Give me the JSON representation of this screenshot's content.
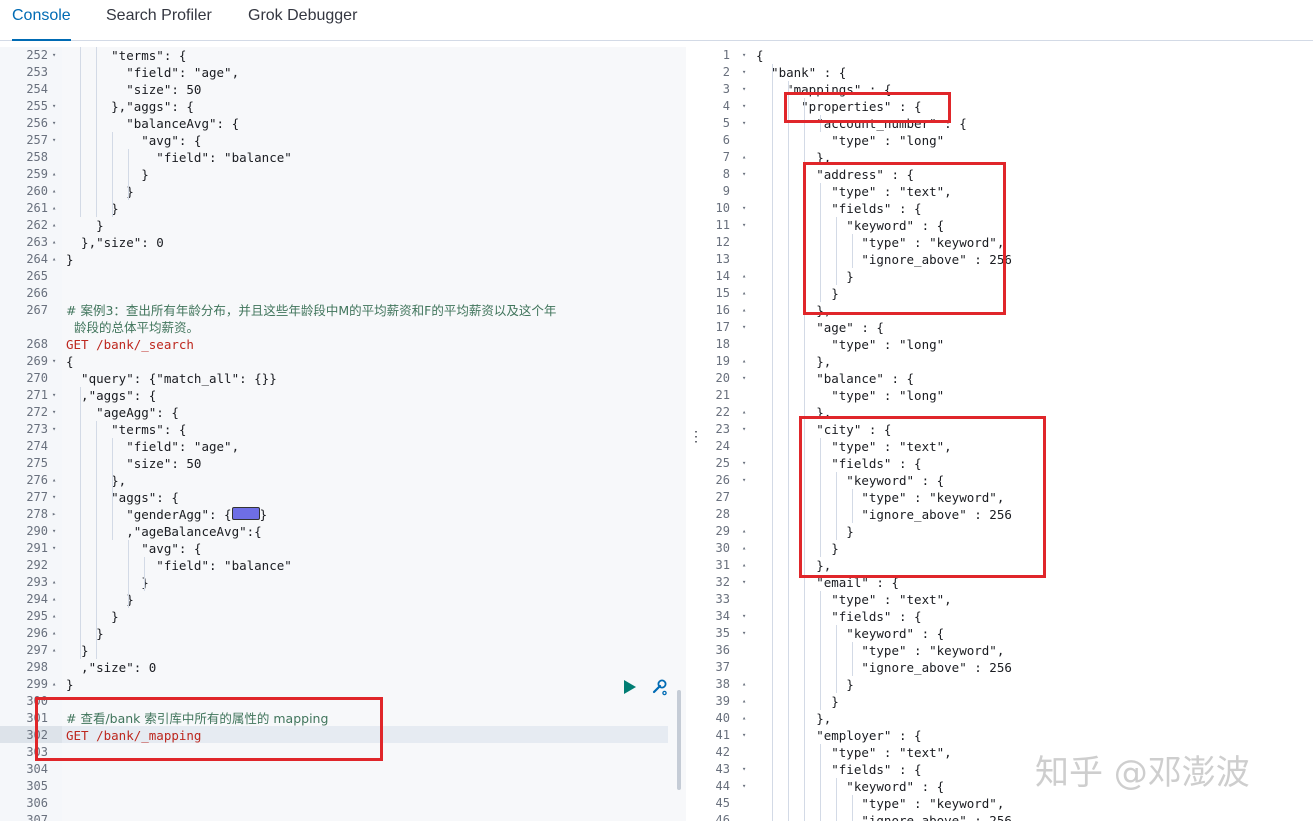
{
  "tabs": [
    "Console",
    "Search Profiler",
    "Grok Debugger"
  ],
  "resizer_icon": "⋮",
  "watermark": "知乎 @邓澎波",
  "colors": {
    "accent": "#006bb4",
    "highlight": "#e0262a",
    "play": "#017d73",
    "comment": "#41755c",
    "method": "#bd271e"
  },
  "left_editor": {
    "lines": [
      {
        "n": "252",
        "fold": "▾",
        "text": "      \"terms\": {"
      },
      {
        "n": "253",
        "fold": "",
        "text": "        \"field\": \"age\","
      },
      {
        "n": "254",
        "fold": "",
        "text": "        \"size\": 50"
      },
      {
        "n": "255",
        "fold": "▾",
        "text": "      },\"aggs\": {"
      },
      {
        "n": "256",
        "fold": "▾",
        "text": "        \"balanceAvg\": {"
      },
      {
        "n": "257",
        "fold": "▾",
        "text": "          \"avg\": {"
      },
      {
        "n": "258",
        "fold": "",
        "text": "            \"field\": \"balance\""
      },
      {
        "n": "259",
        "fold": "▴",
        "text": "          }"
      },
      {
        "n": "260",
        "fold": "▴",
        "text": "        }"
      },
      {
        "n": "261",
        "fold": "▴",
        "text": "      }"
      },
      {
        "n": "262",
        "fold": "▴",
        "text": "    }"
      },
      {
        "n": "263",
        "fold": "▴",
        "text": "  },\"size\": 0"
      },
      {
        "n": "264",
        "fold": "▴",
        "text": "}"
      },
      {
        "n": "265",
        "fold": "",
        "text": ""
      },
      {
        "n": "266",
        "fold": "",
        "text": ""
      },
      {
        "n": "267",
        "fold": "",
        "text": "# 案例3：查出所有年龄分布，并且这些年龄段中M的平均薪资和F的平均薪资以及这个年",
        "type": "comment"
      },
      {
        "n": "",
        "fold": "",
        "text": "  龄段的总体平均薪资。",
        "type": "comment"
      },
      {
        "n": "268",
        "fold": "",
        "text": "GET /bank/_search",
        "type": "method"
      },
      {
        "n": "269",
        "fold": "▾",
        "text": "{"
      },
      {
        "n": "270",
        "fold": "",
        "text": "  \"query\": {\"match_all\": {}}"
      },
      {
        "n": "271",
        "fold": "▾",
        "text": "  ,\"aggs\": {"
      },
      {
        "n": "272",
        "fold": "▾",
        "text": "    \"ageAgg\": {"
      },
      {
        "n": "273",
        "fold": "▾",
        "text": "      \"terms\": {"
      },
      {
        "n": "274",
        "fold": "",
        "text": "        \"field\": \"age\","
      },
      {
        "n": "275",
        "fold": "",
        "text": "        \"size\": 50"
      },
      {
        "n": "276",
        "fold": "▴",
        "text": "      },"
      },
      {
        "n": "277",
        "fold": "▾",
        "text": "      \"aggs\": {"
      },
      {
        "n": "278",
        "fold": "▸",
        "text": "        \"genderAgg\": {",
        "chip": true,
        "after": "}"
      },
      {
        "n": "290",
        "fold": "▾",
        "text": "        ,\"ageBalanceAvg\":{"
      },
      {
        "n": "291",
        "fold": "▾",
        "text": "          \"avg\": {"
      },
      {
        "n": "292",
        "fold": "",
        "text": "            \"field\": \"balance\""
      },
      {
        "n": "293",
        "fold": "▴",
        "text": "          }"
      },
      {
        "n": "294",
        "fold": "▴",
        "text": "        }"
      },
      {
        "n": "295",
        "fold": "▴",
        "text": "      }"
      },
      {
        "n": "296",
        "fold": "▴",
        "text": "    }"
      },
      {
        "n": "297",
        "fold": "▴",
        "text": "  }"
      },
      {
        "n": "298",
        "fold": "",
        "text": "  ,\"size\": 0"
      },
      {
        "n": "299",
        "fold": "▴",
        "text": "}"
      },
      {
        "n": "300",
        "fold": "",
        "text": ""
      },
      {
        "n": "301",
        "fold": "",
        "text": "# 查看/bank 索引库中所有的属性的 mapping",
        "type": "comment"
      },
      {
        "n": "302",
        "fold": "",
        "text": "GET /bank/_mapping",
        "type": "method"
      },
      {
        "n": "303",
        "fold": "",
        "text": ""
      },
      {
        "n": "304",
        "fold": "",
        "text": ""
      },
      {
        "n": "305",
        "fold": "",
        "text": ""
      },
      {
        "n": "306",
        "fold": "",
        "text": ""
      },
      {
        "n": "307",
        "fold": "",
        "text": ""
      }
    ]
  },
  "right_editor": {
    "lines": [
      {
        "n": "1",
        "fold": "▾",
        "text": "{"
      },
      {
        "n": "2",
        "fold": "▾",
        "text": "  \"bank\" : {"
      },
      {
        "n": "3",
        "fold": "▾",
        "text": "    \"mappings\" : {"
      },
      {
        "n": "4",
        "fold": "▾",
        "text": "      \"properties\" : {"
      },
      {
        "n": "5",
        "fold": "▾",
        "text": "        \"account_number\" : {"
      },
      {
        "n": "6",
        "fold": "",
        "text": "          \"type\" : \"long\""
      },
      {
        "n": "7",
        "fold": "▴",
        "text": "        },"
      },
      {
        "n": "8",
        "fold": "▾",
        "text": "        \"address\" : {"
      },
      {
        "n": "9",
        "fold": "",
        "text": "          \"type\" : \"text\","
      },
      {
        "n": "10",
        "fold": "▾",
        "text": "          \"fields\" : {"
      },
      {
        "n": "11",
        "fold": "▾",
        "text": "            \"keyword\" : {"
      },
      {
        "n": "12",
        "fold": "",
        "text": "              \"type\" : \"keyword\","
      },
      {
        "n": "13",
        "fold": "",
        "text": "              \"ignore_above\" : 256"
      },
      {
        "n": "14",
        "fold": "▴",
        "text": "            }"
      },
      {
        "n": "15",
        "fold": "▴",
        "text": "          }"
      },
      {
        "n": "16",
        "fold": "▴",
        "text": "        },"
      },
      {
        "n": "17",
        "fold": "▾",
        "text": "        \"age\" : {"
      },
      {
        "n": "18",
        "fold": "",
        "text": "          \"type\" : \"long\""
      },
      {
        "n": "19",
        "fold": "▴",
        "text": "        },"
      },
      {
        "n": "20",
        "fold": "▾",
        "text": "        \"balance\" : {"
      },
      {
        "n": "21",
        "fold": "",
        "text": "          \"type\" : \"long\""
      },
      {
        "n": "22",
        "fold": "▴",
        "text": "        },"
      },
      {
        "n": "23",
        "fold": "▾",
        "text": "        \"city\" : {"
      },
      {
        "n": "24",
        "fold": "",
        "text": "          \"type\" : \"text\","
      },
      {
        "n": "25",
        "fold": "▾",
        "text": "          \"fields\" : {"
      },
      {
        "n": "26",
        "fold": "▾",
        "text": "            \"keyword\" : {"
      },
      {
        "n": "27",
        "fold": "",
        "text": "              \"type\" : \"keyword\","
      },
      {
        "n": "28",
        "fold": "",
        "text": "              \"ignore_above\" : 256"
      },
      {
        "n": "29",
        "fold": "▴",
        "text": "            }"
      },
      {
        "n": "30",
        "fold": "▴",
        "text": "          }"
      },
      {
        "n": "31",
        "fold": "▴",
        "text": "        },"
      },
      {
        "n": "32",
        "fold": "▾",
        "text": "        \"email\" : {"
      },
      {
        "n": "33",
        "fold": "",
        "text": "          \"type\" : \"text\","
      },
      {
        "n": "34",
        "fold": "▾",
        "text": "          \"fields\" : {"
      },
      {
        "n": "35",
        "fold": "▾",
        "text": "            \"keyword\" : {"
      },
      {
        "n": "36",
        "fold": "",
        "text": "              \"type\" : \"keyword\","
      },
      {
        "n": "37",
        "fold": "",
        "text": "              \"ignore_above\" : 256"
      },
      {
        "n": "38",
        "fold": "▴",
        "text": "            }"
      },
      {
        "n": "39",
        "fold": "▴",
        "text": "          }"
      },
      {
        "n": "40",
        "fold": "▴",
        "text": "        },"
      },
      {
        "n": "41",
        "fold": "▾",
        "text": "        \"employer\" : {"
      },
      {
        "n": "42",
        "fold": "",
        "text": "          \"type\" : \"text\","
      },
      {
        "n": "43",
        "fold": "▾",
        "text": "          \"fields\" : {"
      },
      {
        "n": "44",
        "fold": "▾",
        "text": "            \"keyword\" : {"
      },
      {
        "n": "45",
        "fold": "",
        "text": "              \"type\" : \"keyword\","
      },
      {
        "n": "46",
        "fold": "",
        "text": "              \"ignore_above\" : 256"
      }
    ]
  }
}
